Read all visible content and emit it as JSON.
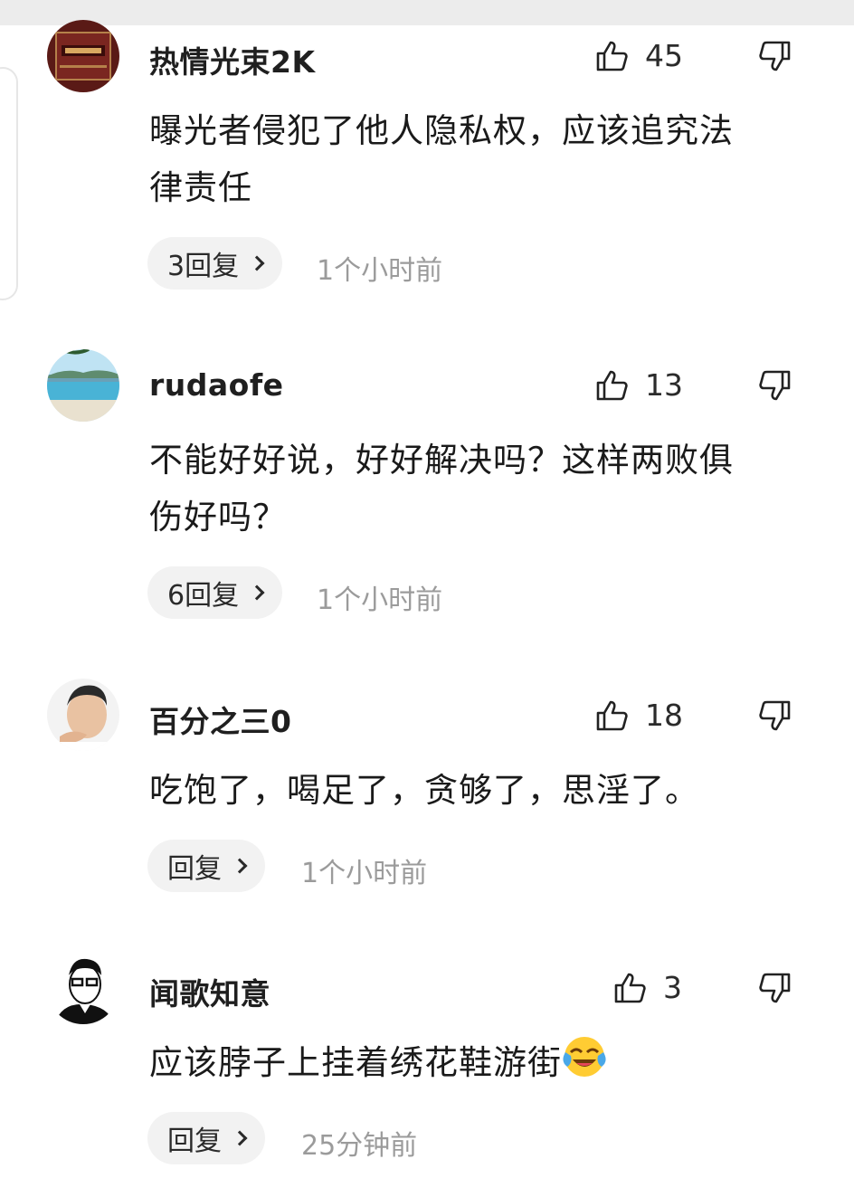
{
  "comments": [
    {
      "username": "热情光束2K",
      "likes": "45",
      "text_lines": [
        "曝光者侵犯了他人隐私权，应该追究法",
        "律责任"
      ],
      "reply_label": "3回复",
      "time": "1个小时前",
      "avatar": "dark-red-box-avatar"
    },
    {
      "username": "rudaofe",
      "likes": "13",
      "text_lines": [
        "不能好好说，好好解决吗？这样两败俱",
        "伤好吗？"
      ],
      "reply_label": "6回复",
      "time": "1个小时前",
      "avatar": "beach-scenery-avatar"
    },
    {
      "username": "百分之三0",
      "likes": "18",
      "text_lines": [
        "吃饱了，喝足了，贪够了，思淫了。"
      ],
      "reply_label": "回复",
      "time": "1个小时前",
      "avatar": "man-portrait-avatar"
    },
    {
      "username": "闻歌知意",
      "likes": "3",
      "text_lines": [
        "应该脖子上挂着绣花鞋游街"
      ],
      "trailing_emoji": "laughing-crying-emoji",
      "reply_label": "回复",
      "time": "25分钟前",
      "avatar": "man-glasses-sketch-avatar"
    }
  ],
  "icons": {
    "like": "thumbs-up-icon",
    "dislike": "thumbs-down-icon",
    "reply_arrow": "chevron-right-icon"
  },
  "colors": {
    "text": "#1a1a1a",
    "muted": "#9b9b9b",
    "pill_bg": "#f2f2f2"
  }
}
